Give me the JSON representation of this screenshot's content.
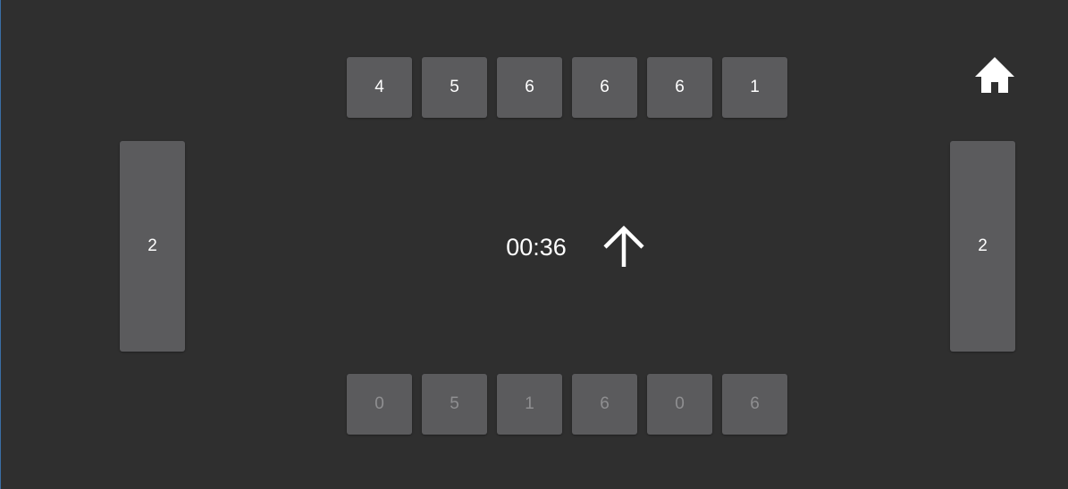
{
  "top_pits": [
    "4",
    "5",
    "6",
    "6",
    "6",
    "1"
  ],
  "bottom_pits": [
    "0",
    "5",
    "1",
    "6",
    "0",
    "6"
  ],
  "left_store": "2",
  "right_store": "2",
  "timer": "00:36",
  "turn_indicator_icon": "arrow-up-icon",
  "home_icon": "home-icon",
  "colors": {
    "background": "#2f2f2f",
    "tile": "#5b5b5d",
    "text": "#ffffff",
    "inactive_text": "#8f8f91"
  }
}
